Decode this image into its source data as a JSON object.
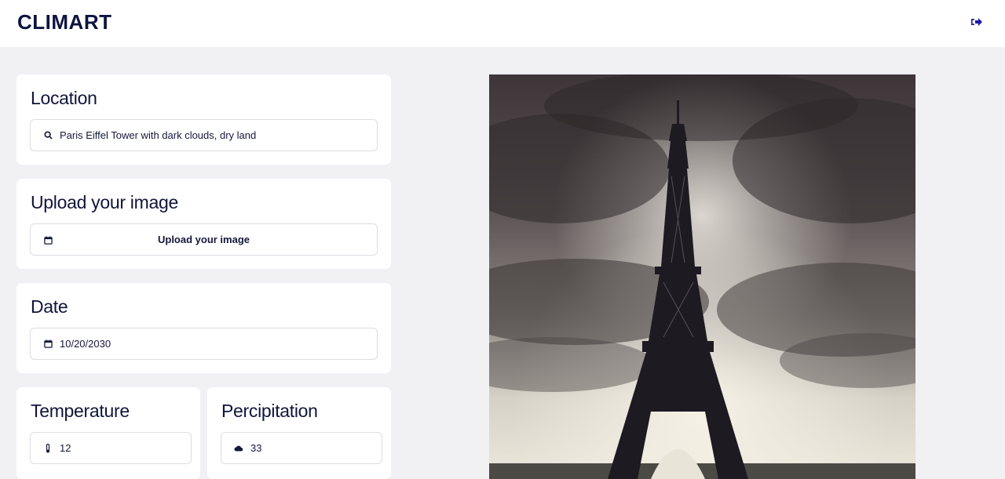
{
  "app": {
    "brand": "CLIMART"
  },
  "header": {
    "logout_icon": "logout-icon"
  },
  "location": {
    "title": "Location",
    "search_value": "Paris Eiffel Tower with dark clouds, dry land",
    "icon": "search-icon"
  },
  "upload": {
    "title": "Upload your image",
    "button_label": "Upload your image",
    "icon": "calendar-icon"
  },
  "date": {
    "title": "Date",
    "value": "10/20/2030",
    "icon": "calendar-icon"
  },
  "temperature": {
    "title": "Temperature",
    "value": "12",
    "icon": "thermometer-icon"
  },
  "precipitation": {
    "title": "Percipitation",
    "value": "33",
    "icon": "cloud-icon"
  },
  "image": {
    "subject": "eiffel-tower-dark-clouds"
  },
  "colors": {
    "accent": "#1a1aa8",
    "text": "#0d1233",
    "background": "#f1f1f4"
  }
}
